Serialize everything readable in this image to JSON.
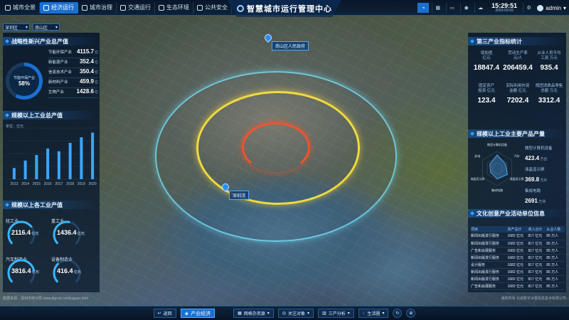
{
  "header": {
    "title": "智慧城市运行管理中心",
    "nav": [
      {
        "label": "城市全景",
        "icon": "grid-icon",
        "active": false
      },
      {
        "label": "经济运行",
        "icon": "chart-icon",
        "active": true
      },
      {
        "label": "城市治理",
        "icon": "shield-icon",
        "active": false
      },
      {
        "label": "交通运行",
        "icon": "car-icon",
        "active": false
      },
      {
        "label": "生态环境",
        "icon": "leaf-icon",
        "active": false
      },
      {
        "label": "公共安全",
        "icon": "alert-icon",
        "active": false
      }
    ],
    "time": "15:29:51",
    "date": "2023-03-02",
    "user": "admin"
  },
  "filters": {
    "district": "深圳区",
    "subdistrict": "南山区"
  },
  "map": {
    "label_gov": "南山区人民政府",
    "label_park": "深圳湾",
    "rings": [
      "outer",
      "middle",
      "inner"
    ]
  },
  "left": {
    "strategic": {
      "title": "战略性新兴产业总产值",
      "donut_label": "节能环保产业",
      "donut_value": "58%",
      "donut_fraction": 0.58,
      "items": [
        {
          "name": "节能环保产业",
          "value": "4115.7",
          "unit": "亿"
        },
        {
          "name": "新能源产业",
          "value": "352.4",
          "unit": "亿"
        },
        {
          "name": "信息技术产业",
          "value": "350.4",
          "unit": "亿"
        },
        {
          "name": "新材料产业",
          "value": "459.9",
          "unit": "亿"
        },
        {
          "name": "生物产业",
          "value": "1428.6",
          "unit": "亿"
        }
      ]
    },
    "industrial_output": {
      "title": "规模以上工业总产值",
      "unit": "单位：亿元"
    },
    "industries": {
      "title": "规模以上各工业产值",
      "gauges": [
        {
          "name": "轻工业",
          "value": "2116.4",
          "unit": "亿元",
          "fraction": 0.7
        },
        {
          "name": "重工业",
          "value": "1436.4",
          "unit": "亿元",
          "fraction": 0.55
        },
        {
          "name": "汽车制造业",
          "value": "3816.4",
          "unit": "亿元",
          "fraction": 0.8
        },
        {
          "name": "设备制造业",
          "value": "416.4",
          "unit": "亿元",
          "fraction": 0.35
        }
      ]
    }
  },
  "chart_data": {
    "type": "bar",
    "title": "规模以上工业总产值",
    "ylabel": "单位：亿元",
    "categories": [
      "2013",
      "2014",
      "2015",
      "2016",
      "2017",
      "2018",
      "2019",
      "2020"
    ],
    "values": [
      120,
      200,
      260,
      330,
      300,
      390,
      450,
      500
    ],
    "ylim": [
      0,
      550
    ]
  },
  "right": {
    "tertiary": {
      "title": "第三产业指标统计",
      "stats": [
        {
          "label": "增加值\n亿元",
          "value": "18847.4"
        },
        {
          "label": "劳动生产率\n元/人",
          "value": "206459.4"
        },
        {
          "label": "从业人员平均\n工资 万元",
          "value": "935.4"
        },
        {
          "label": "固定资产\n投资 亿元",
          "value": "123.4"
        },
        {
          "label": "实际利用外资\n金额 亿元",
          "value": "7202.4"
        },
        {
          "label": "规团消费品零售\n总额 万元",
          "value": "3312.4"
        }
      ]
    },
    "products": {
      "title": "规模以上工业主要产品产量",
      "radar_labels": [
        "微型计算机设备",
        "汽车",
        "液晶显示屏",
        "集成电路",
        "液晶显示屏",
        "彩电"
      ],
      "radar_values": [
        0.8,
        0.55,
        0.7,
        0.6,
        0.45,
        0.5
      ],
      "items": [
        {
          "name": "微型计算机设备",
          "value": "423.4",
          "unit": "万台"
        },
        {
          "name": "液晶显示屏",
          "value": "369.8",
          "unit": "万片"
        },
        {
          "name": "集成电路",
          "value": "2691",
          "unit": "万块"
        }
      ]
    },
    "culture": {
      "title": "文化创意产业活动单位信息",
      "columns": [
        "项目",
        "资产总计",
        "收入合计",
        "从业人数"
      ],
      "rows": [
        [
          "新闻出版发行服务",
          "1682 亿元",
          "817 亿元",
          "85 万人"
        ],
        [
          "新闻出版发行服务",
          "1682 亿元",
          "817 亿元",
          "85 万人"
        ],
        [
          "广告和会展服务",
          "1682 亿元",
          "817 亿元",
          "85 万人"
        ],
        [
          "新闻出版发行服务",
          "1682 亿元",
          "817 亿元",
          "85 万人"
        ],
        [
          "设计服务",
          "1682 亿元",
          "817 亿元",
          "85 万人"
        ],
        [
          "新闻出版发行服务",
          "1682 亿元",
          "817 亿元",
          "85 万人"
        ],
        [
          "新闻出版发行服务",
          "1682 亿元",
          "817 亿元",
          "85 万人"
        ],
        [
          "广告和会展服务",
          "1682 亿元",
          "817 亿元",
          "85 万人"
        ]
      ]
    }
  },
  "bottom": {
    "back": "返回",
    "main": "产业经济",
    "tools": [
      "网格办资源",
      "关注对象",
      "三产分析",
      "生活圈"
    ]
  },
  "footnote_left": "数据来源：深圳市统计局 www.dtgrail.com/juguan.html",
  "footnote_right": "版权所有 北京数字冰雹信息技术有限公司",
  "colors": {
    "accent": "#1b6fd0",
    "ring_outer": "#78e6ff",
    "ring_mid": "#ffe63c",
    "ring_inner": "#ff5028"
  }
}
